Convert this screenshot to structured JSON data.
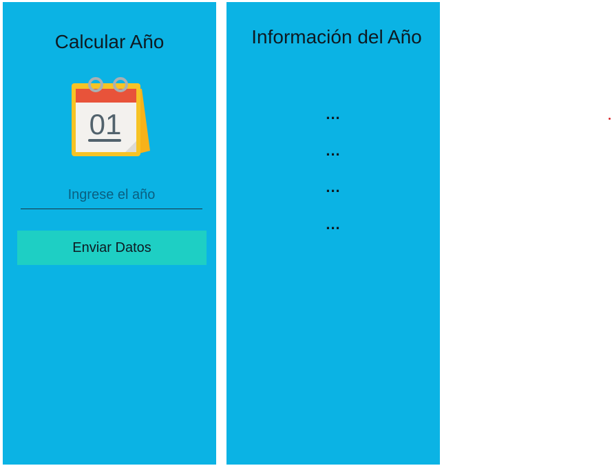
{
  "left_panel": {
    "title": "Calcular Año",
    "calendar_icon": {
      "name": "calendar-icon",
      "day_text": "01"
    },
    "year_input": {
      "placeholder": "Ingrese el año",
      "value": ""
    },
    "submit_button_label": "Enviar Datos"
  },
  "right_panel": {
    "title": "Información del Año",
    "info_lines": [
      "...",
      "...",
      "...",
      "..."
    ]
  },
  "colors": {
    "panel_background": "#0bb3e4",
    "button_background": "#1ecfc4",
    "text": "#0e1a22",
    "placeholder": "#0a5f80"
  }
}
